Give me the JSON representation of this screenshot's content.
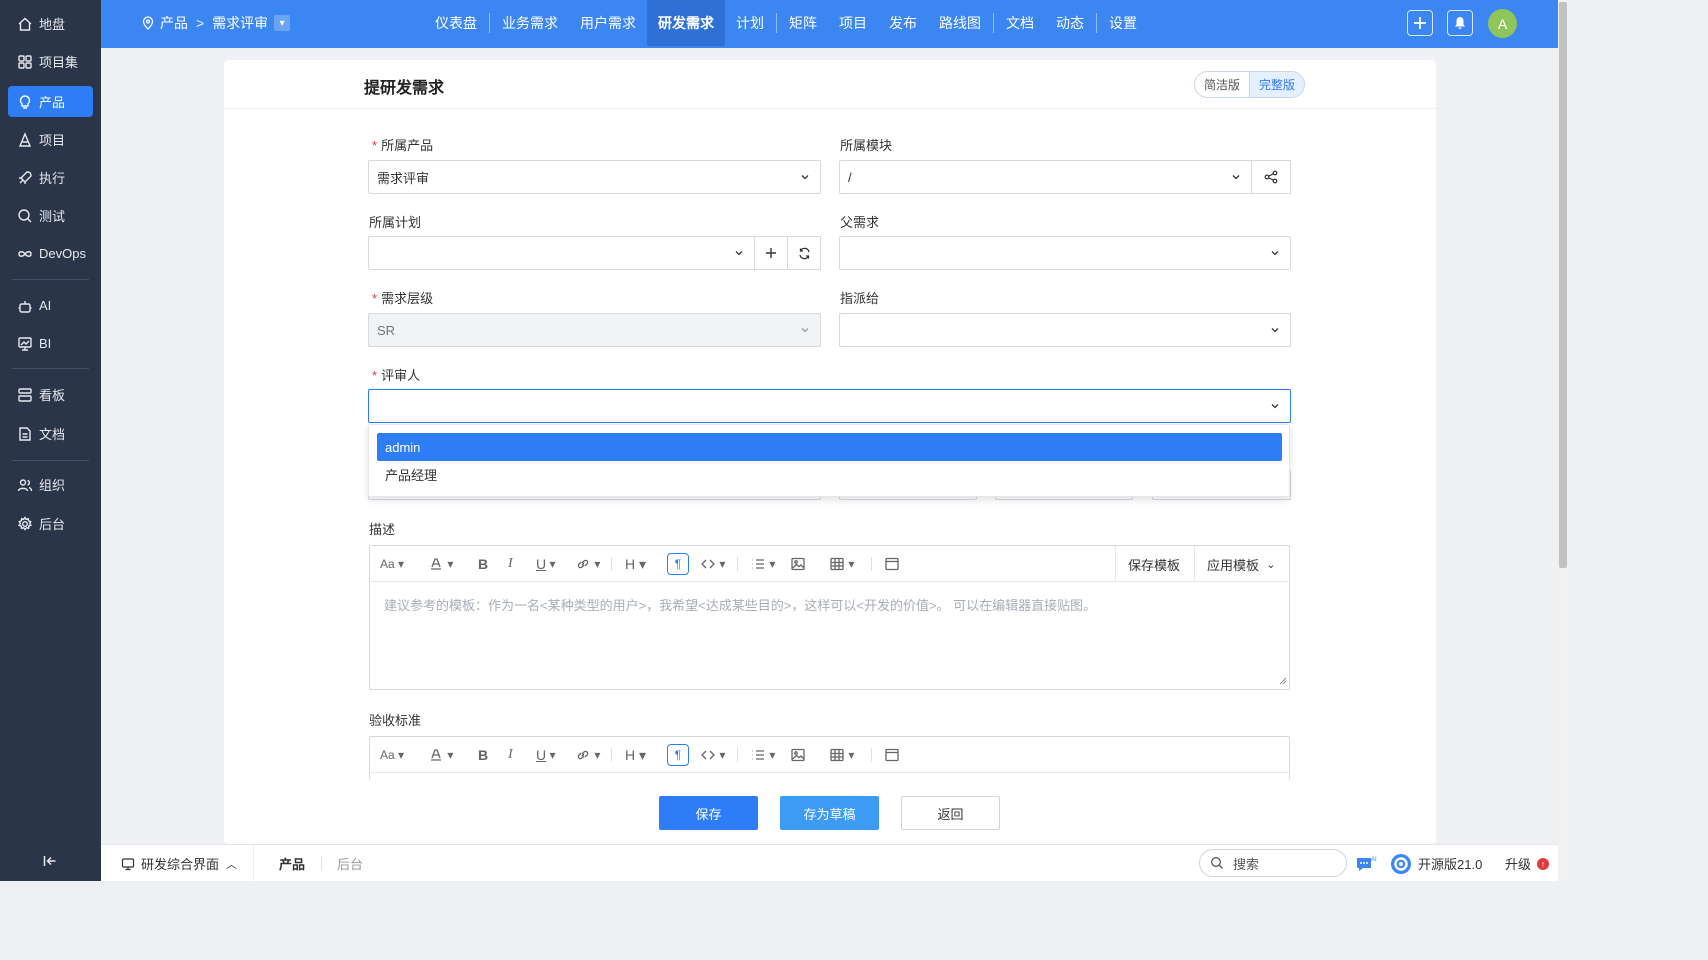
{
  "sidebar": {
    "items": [
      {
        "label": "地盘",
        "icon": "home-icon"
      },
      {
        "label": "项目集",
        "icon": "grid-icon"
      },
      {
        "label": "产品",
        "icon": "bulb-icon"
      },
      {
        "label": "项目",
        "icon": "project-icon"
      },
      {
        "label": "执行",
        "icon": "rocket-icon"
      },
      {
        "label": "测试",
        "icon": "test-icon"
      },
      {
        "label": "DevOps",
        "icon": "infinity-icon"
      },
      {
        "label": "AI",
        "icon": "robot-icon"
      },
      {
        "label": "BI",
        "icon": "chart-icon"
      },
      {
        "label": "看板",
        "icon": "kanban-icon"
      },
      {
        "label": "文档",
        "icon": "doc-icon"
      },
      {
        "label": "组织",
        "icon": "people-icon"
      },
      {
        "label": "后台",
        "icon": "gear-icon"
      }
    ],
    "active": "产品"
  },
  "topbar": {
    "breadcrumb": {
      "product": "产品",
      "current": "需求评审"
    },
    "nav": [
      "仪表盘",
      "业务需求",
      "用户需求",
      "研发需求",
      "计划",
      "矩阵",
      "项目",
      "发布",
      "路线图",
      "文档",
      "动态",
      "设置"
    ],
    "active_nav": "研发需求",
    "avatar": "A"
  },
  "page": {
    "title": "提研发需求",
    "modes": [
      "简洁版",
      "完整版"
    ],
    "active_mode": "完整版"
  },
  "form": {
    "product": {
      "label": "所属产品",
      "required": true,
      "value": "需求评审"
    },
    "module": {
      "label": "所属模块",
      "value": "/"
    },
    "plan": {
      "label": "所属计划",
      "value": ""
    },
    "parent": {
      "label": "父需求",
      "value": ""
    },
    "grade": {
      "label": "需求层级",
      "required": true,
      "value": "SR"
    },
    "assign": {
      "label": "指派给",
      "value": ""
    },
    "reviewer": {
      "label": "评审人",
      "required": true,
      "value": "",
      "options": [
        "admin",
        "产品经理"
      ],
      "highlighted": "admin"
    },
    "description": {
      "label": "描述",
      "placeholder": "建议参考的模板：作为一名<某种类型的用户>，我希望<达成某些目的>，这样可以<开发的价值>。 可以在编辑器直接贴图。",
      "save_template": "保存模板",
      "apply_template": "应用模板"
    },
    "acceptance": {
      "label": "验收标准"
    }
  },
  "editor_toolbar": {
    "font": "Aa",
    "heading": "H",
    "bold": "B",
    "italic": "I",
    "underline": "U"
  },
  "actions": {
    "save": "保存",
    "draft": "存为草稿",
    "back": "返回"
  },
  "bottombar": {
    "interface": "研发综合界面",
    "tabs": [
      "产品",
      "后台"
    ],
    "active_tab": "产品",
    "search_placeholder": "搜索",
    "version": "开源版21.0",
    "upgrade": "升级"
  },
  "colors": {
    "primary": "#2e7cf6",
    "topbar": "#3b86f0",
    "sidebar": "#2b3548"
  }
}
